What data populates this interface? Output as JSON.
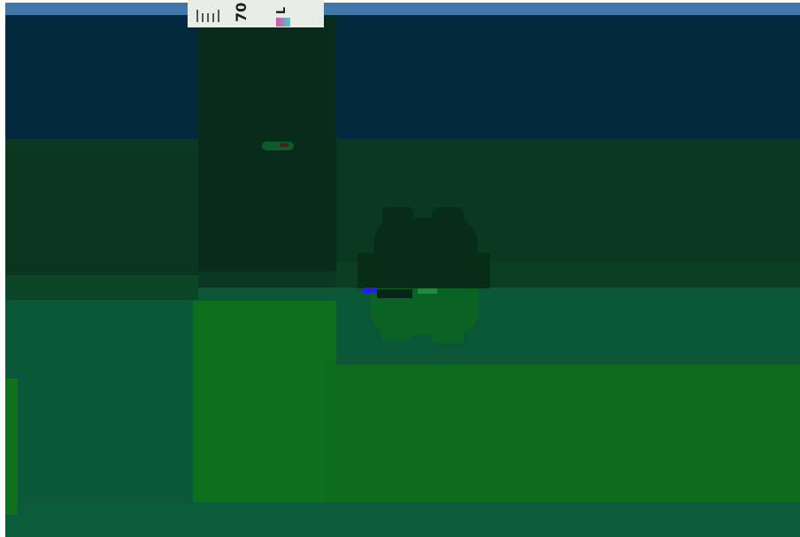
{
  "image": {
    "ruler_label": "70",
    "ruler_letter": "L"
  },
  "palette": {
    "sky": "#3f77a8",
    "navy": "#03293e",
    "dark_green": "#0b3820",
    "teal_green": "#0a5636",
    "bright_green": "#0d6e1d",
    "artifact_blue": "#1f1fe8"
  }
}
